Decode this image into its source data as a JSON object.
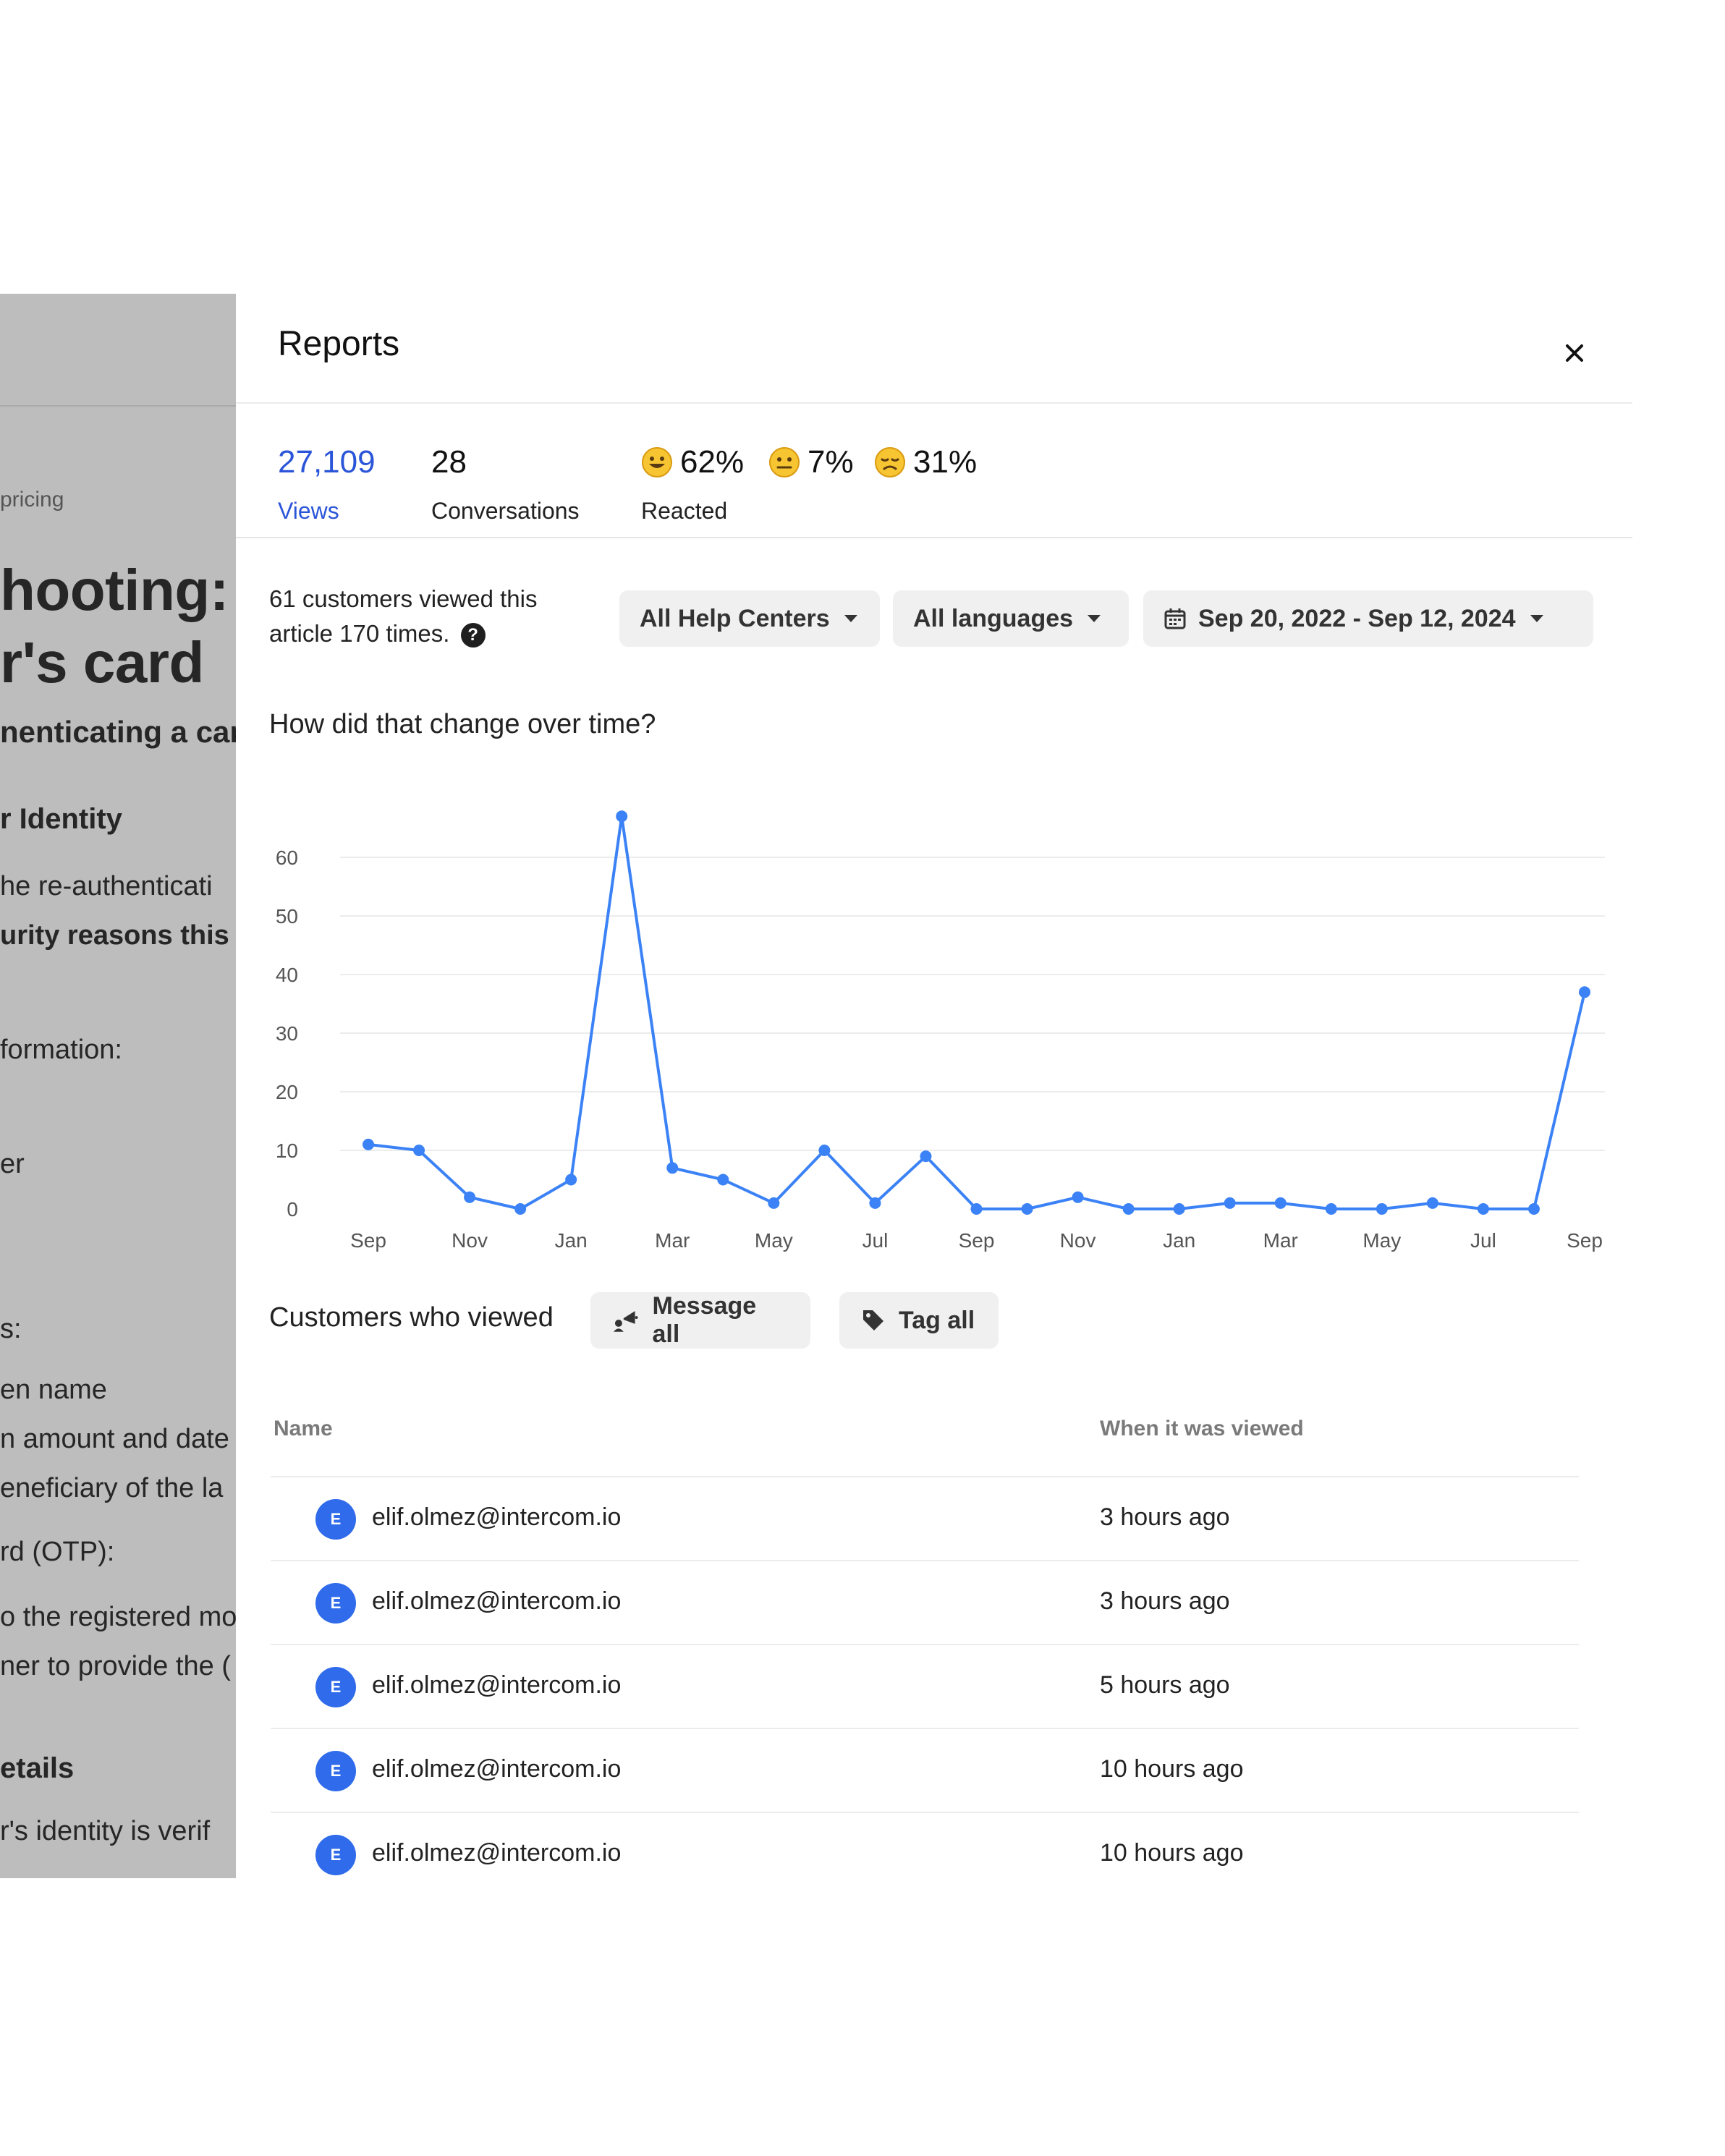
{
  "background_article": {
    "breadcrumb": "pricing",
    "title_line1": "hooting:",
    "title_line2": "r's card",
    "subtitle": "nenticating a car",
    "heading_identity": "r Identity",
    "line_reauth": "he re-authenticati",
    "line_security": "urity reasons this",
    "line_information": "formation:",
    "line_er": "er",
    "line_s": "s:",
    "line_name": "en name",
    "line_amount": "n amount and date",
    "line_beneficiary": "eneficiary of the la",
    "line_otp": "rd (OTP):",
    "line_registered": "o the registered mo",
    "line_provide": "ner to provide the (",
    "heading_details": "etails",
    "line_verified": "r's identity is verif"
  },
  "panel": {
    "title": "Reports",
    "close_icon": "close-icon"
  },
  "stats": {
    "views_value": "27,109",
    "views_label": "Views",
    "conversations_value": "28",
    "conversations_label": "Conversations",
    "reactions": [
      {
        "icon": "happy-face-icon",
        "value": "62%"
      },
      {
        "icon": "neutral-face-icon",
        "value": "7%"
      },
      {
        "icon": "sad-face-icon",
        "value": "31%"
      }
    ],
    "reacted_label": "Reacted",
    "accent_color": "#2b55d8"
  },
  "summary": {
    "line1": "61 customers viewed this",
    "line2": "article 170 times."
  },
  "filters": {
    "help_centers": "All Help Centers",
    "languages": "All languages",
    "date_range": "Sep 20, 2022 - Sep 12, 2024"
  },
  "chart_section_title": "How did that change over time?",
  "chart_data": {
    "type": "line",
    "title": "",
    "xlabel": "",
    "ylabel": "",
    "ylim": [
      0,
      60
    ],
    "yticks": [
      0,
      10,
      20,
      30,
      40,
      50,
      60
    ],
    "grid": true,
    "color": "#3b82f6",
    "x_tick_labels": [
      "Sep",
      "Nov",
      "Jan",
      "Mar",
      "May",
      "Jul",
      "Sep",
      "Nov",
      "Jan",
      "Mar",
      "May",
      "Jul",
      "Sep"
    ],
    "x": [
      "2022-09",
      "2022-10",
      "2022-11",
      "2022-12",
      "2023-01",
      "2023-02",
      "2023-03",
      "2023-04",
      "2023-05",
      "2023-06",
      "2023-07",
      "2023-08",
      "2023-09",
      "2023-10",
      "2023-11",
      "2023-12",
      "2024-01",
      "2024-02",
      "2024-03",
      "2024-04",
      "2024-05",
      "2024-06",
      "2024-07",
      "2024-08",
      "2024-09"
    ],
    "values": [
      11,
      10,
      2,
      0,
      5,
      67,
      7,
      5,
      1,
      10,
      1,
      9,
      0,
      0,
      2,
      0,
      0,
      1,
      1,
      0,
      0,
      1,
      0,
      0,
      37
    ]
  },
  "customers": {
    "title": "Customers who viewed",
    "message_all": "Message all",
    "tag_all": "Tag all",
    "col_name": "Name",
    "col_when": "When it was viewed",
    "rows": [
      {
        "initial": "E",
        "email": "elif.olmez@intercom.io",
        "when": "3 hours ago"
      },
      {
        "initial": "E",
        "email": "elif.olmez@intercom.io",
        "when": "3 hours ago"
      },
      {
        "initial": "E",
        "email": "elif.olmez@intercom.io",
        "when": "5 hours ago"
      },
      {
        "initial": "E",
        "email": "elif.olmez@intercom.io",
        "when": "10 hours ago"
      },
      {
        "initial": "E",
        "email": "elif.olmez@intercom.io",
        "when": "10 hours ago"
      }
    ]
  }
}
